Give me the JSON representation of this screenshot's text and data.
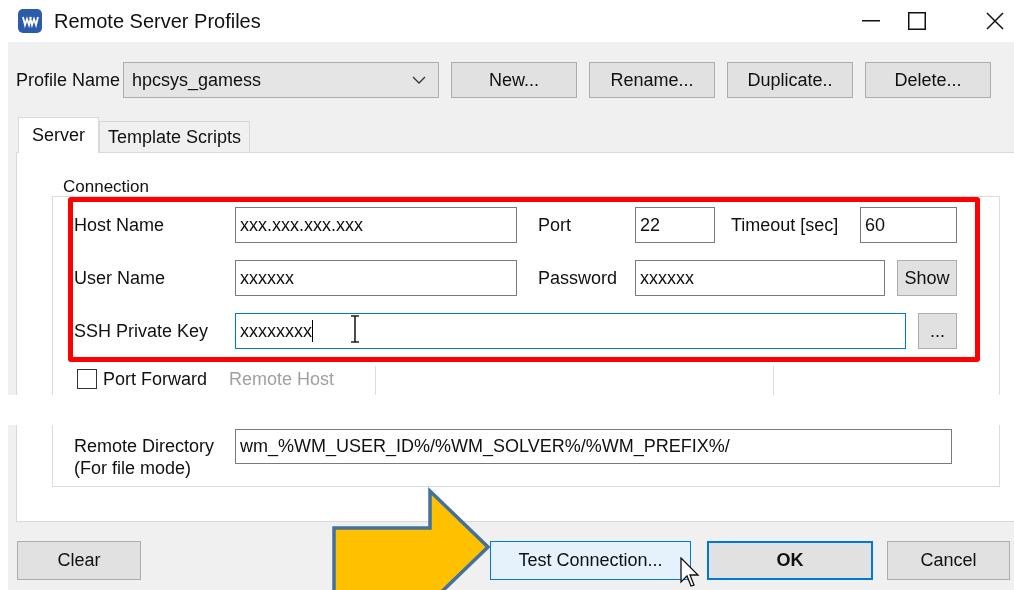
{
  "window": {
    "title": "Remote Server Profiles"
  },
  "profile": {
    "label": "Profile Name",
    "value": "hpcsys_gamess",
    "buttons": [
      "New...",
      "Rename...",
      "Duplicate..",
      "Delete..."
    ]
  },
  "tabs": [
    {
      "label": "Server",
      "selected": true
    },
    {
      "label": "Template Scripts",
      "selected": false
    }
  ],
  "connection": {
    "title": "Connection",
    "host_label": "Host Name",
    "host": "xxx.xxx.xxx.xxx",
    "port_label": "Port",
    "port": "22",
    "timeout_label": "Timeout [sec]",
    "timeout": "60",
    "user_label": "User Name",
    "user": "xxxxxx",
    "password_label": "Password",
    "password": "xxxxxx",
    "show_button": "Show",
    "key_label": "SSH Private Key",
    "key": "xxxxxxxx",
    "key_focused": true,
    "browse_button": "..."
  },
  "port_forward": {
    "label": "Port Forward",
    "checked": false,
    "remote_host_label": "Remote Host",
    "remote_host_disabled": true
  },
  "remote_directory": {
    "label": [
      "Remote Directory",
      "(For file mode)"
    ],
    "value": "wm_%WM_USER_ID%/%WM_SOLVER%/%WM_PREFIX%/"
  },
  "footer_buttons": [
    {
      "label": "Clear",
      "kind": "normal"
    },
    {
      "label": "Test Connection...",
      "kind": "hover"
    },
    {
      "label": "OK",
      "kind": "default"
    },
    {
      "label": "Cancel",
      "kind": "normal"
    }
  ]
}
